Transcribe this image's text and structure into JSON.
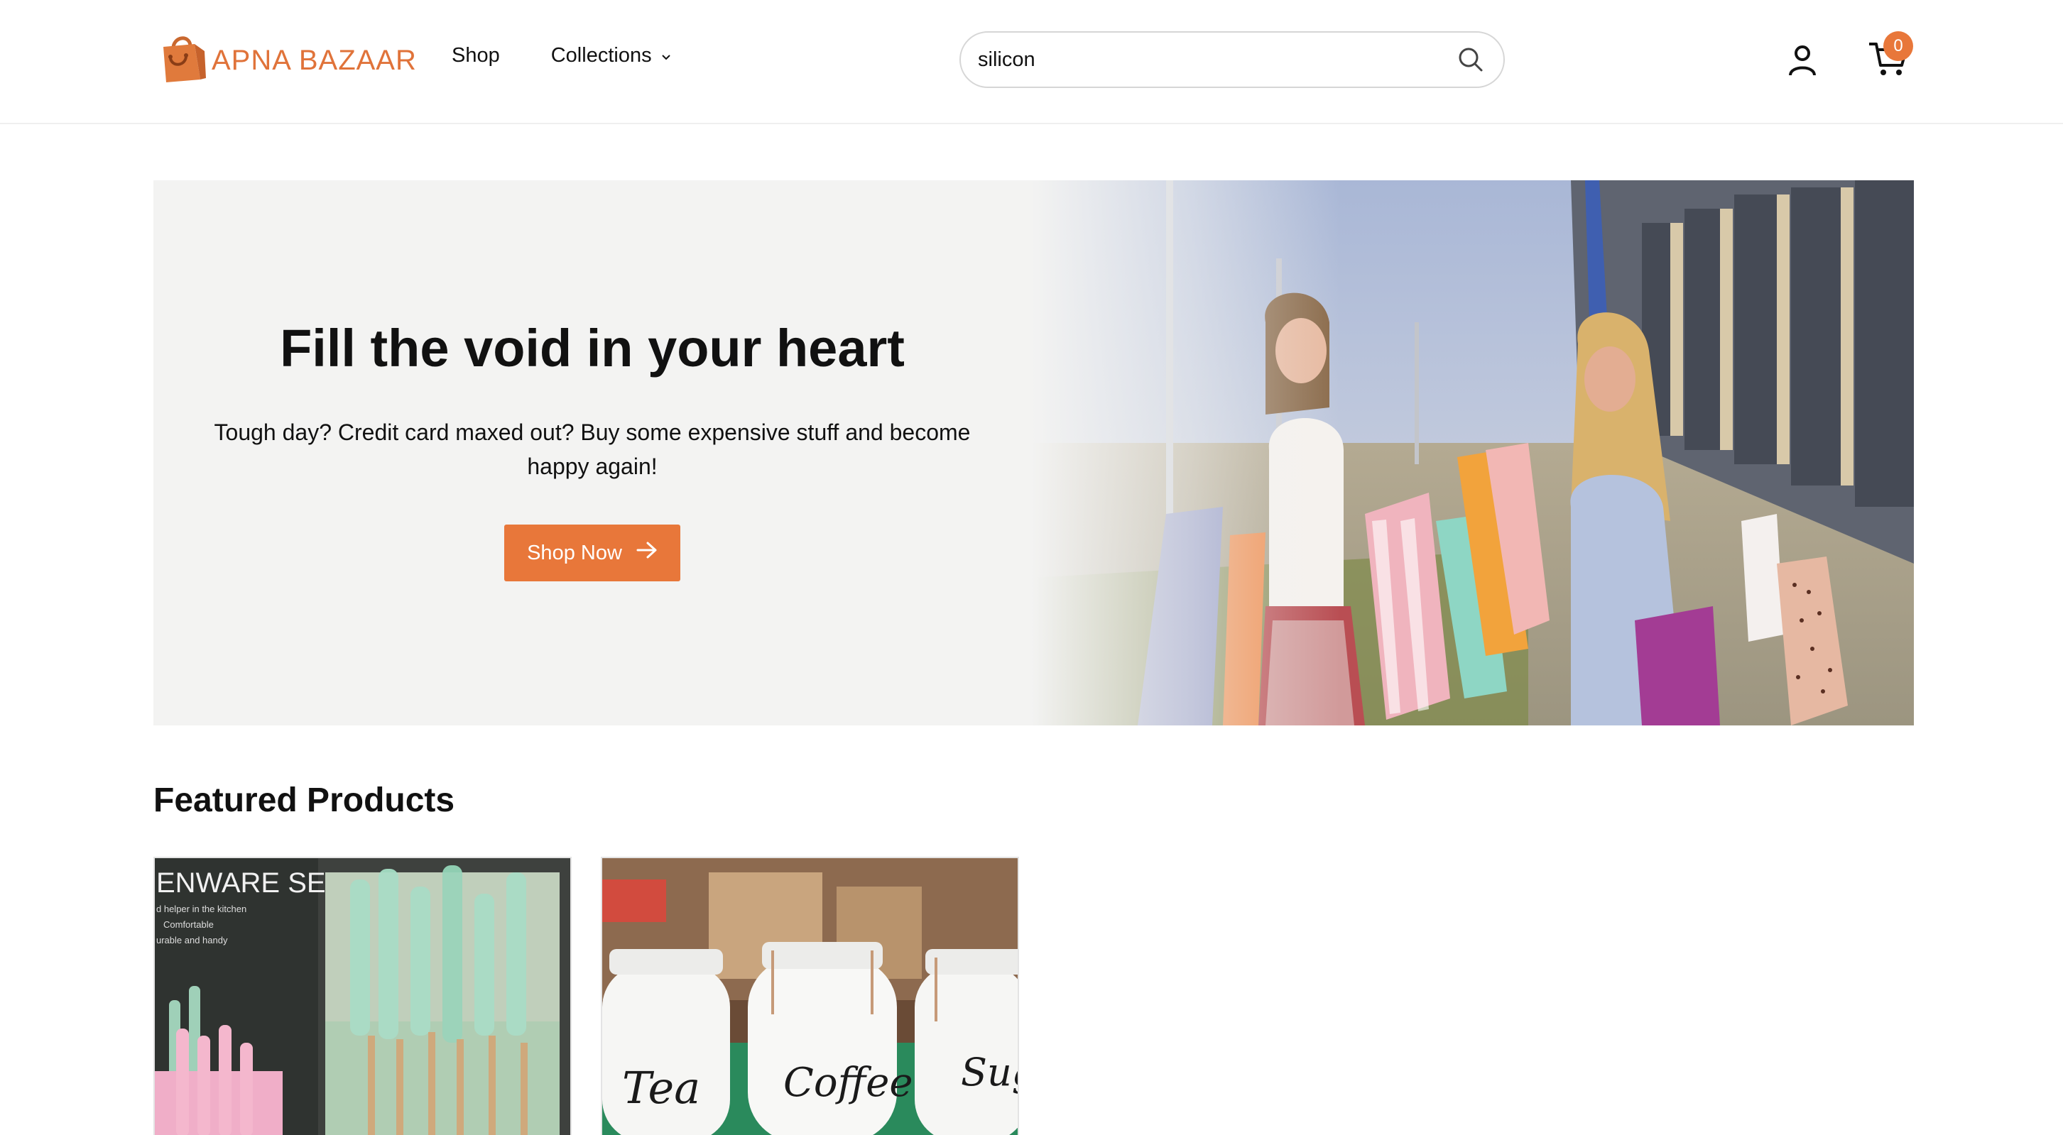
{
  "brand": {
    "name": "APNA BAZAAR",
    "accent_color": "#e8773a",
    "logo_icon": "shopping-bag-icon"
  },
  "nav": {
    "shop_label": "Shop",
    "collections_label": "Collections"
  },
  "search": {
    "value": "silicon",
    "icon": "search-icon"
  },
  "header_icons": {
    "account_icon": "user-icon",
    "cart_icon": "cart-icon",
    "cart_count": "0"
  },
  "hero": {
    "title": "Fill the void in your heart",
    "subtitle": "Tough day? Credit card maxed out? Buy some expensive stuff and become happy again!",
    "cta_label": "Shop Now",
    "cta_icon": "arrow-right-icon",
    "background_color": "#f3f3f2"
  },
  "featured": {
    "title": "Featured Products",
    "products": [
      {
        "image_text": "ENWARE SET",
        "image_lines": [
          "d helper in the kitchen",
          "Comfortable",
          "urable and handy"
        ]
      },
      {
        "jar_labels": [
          "Tea",
          "Coffee",
          "Sug"
        ]
      }
    ]
  }
}
